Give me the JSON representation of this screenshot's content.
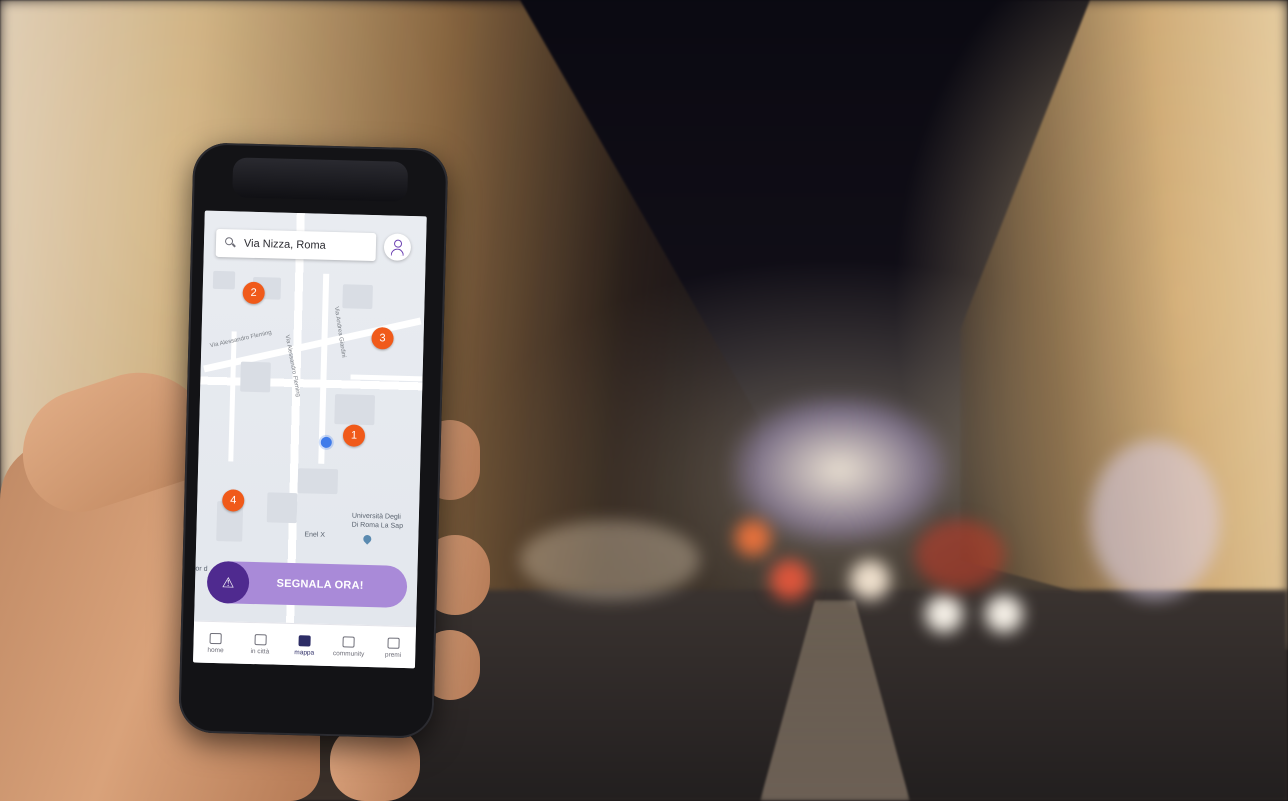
{
  "app": {
    "search": {
      "value": "Via Nizza, Roma",
      "icon": "search-icon"
    },
    "profile_icon": "user-icon",
    "map": {
      "pins": [
        "1",
        "2",
        "3",
        "4"
      ],
      "labels": {
        "street_1": "Via Alessandro Fleming",
        "street_2": "Via Alessandro Fleming",
        "street_3": "Via Andrea Giardini",
        "poi_1": "Università Degli",
        "poi_2": "Di Roma La Sap",
        "poi_3": "Enel X",
        "edge": "or d"
      },
      "pin_color": "#f05a1a",
      "location_color": "#3f7bea"
    },
    "cta": {
      "label": "SEGNALA ORA!",
      "icon": "warning-icon",
      "color": "#a98ad8",
      "icon_bg": "#4f2a8f"
    },
    "tabs": [
      {
        "label": "home",
        "icon": "home-icon"
      },
      {
        "label": "in città",
        "icon": "document-icon"
      },
      {
        "label": "mappa",
        "icon": "map-icon",
        "active": true
      },
      {
        "label": "community",
        "icon": "people-icon"
      },
      {
        "label": "premi",
        "icon": "trophy-icon"
      }
    ]
  }
}
